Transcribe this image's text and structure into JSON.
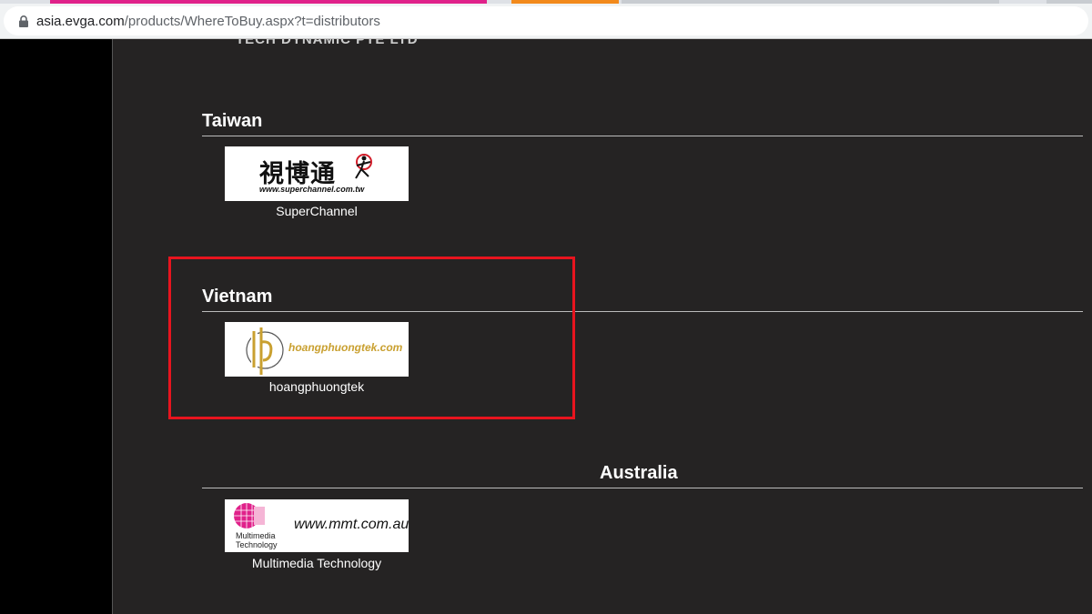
{
  "browser": {
    "url_host": "asia.evga.com",
    "url_path": "/products/WhereToBuy.aspx?t=distributors",
    "lock_icon": "lock-icon"
  },
  "page": {
    "cutoff_text": "TECH DYNAMIC PTE LTD",
    "sections": [
      {
        "title": "Taiwan",
        "distributor": "SuperChannel",
        "logo_text_cn": "視博通",
        "logo_url": "www.superchannel.com.tw"
      },
      {
        "title": "Vietnam",
        "distributor": "hoangphuongtek",
        "logo_text": "hoangphuongtek.com"
      },
      {
        "title": "Australia",
        "distributor": "Multimedia Technology",
        "logo_url": "www.mmt.com.au",
        "logo_name_line1": "Multimedia",
        "logo_name_line2": "Technology"
      }
    ]
  },
  "colors": {
    "page_bg": "#252323",
    "highlight": "#e8141e",
    "hp_gold": "#c9a030",
    "mmt_pink": "#e0218a"
  }
}
